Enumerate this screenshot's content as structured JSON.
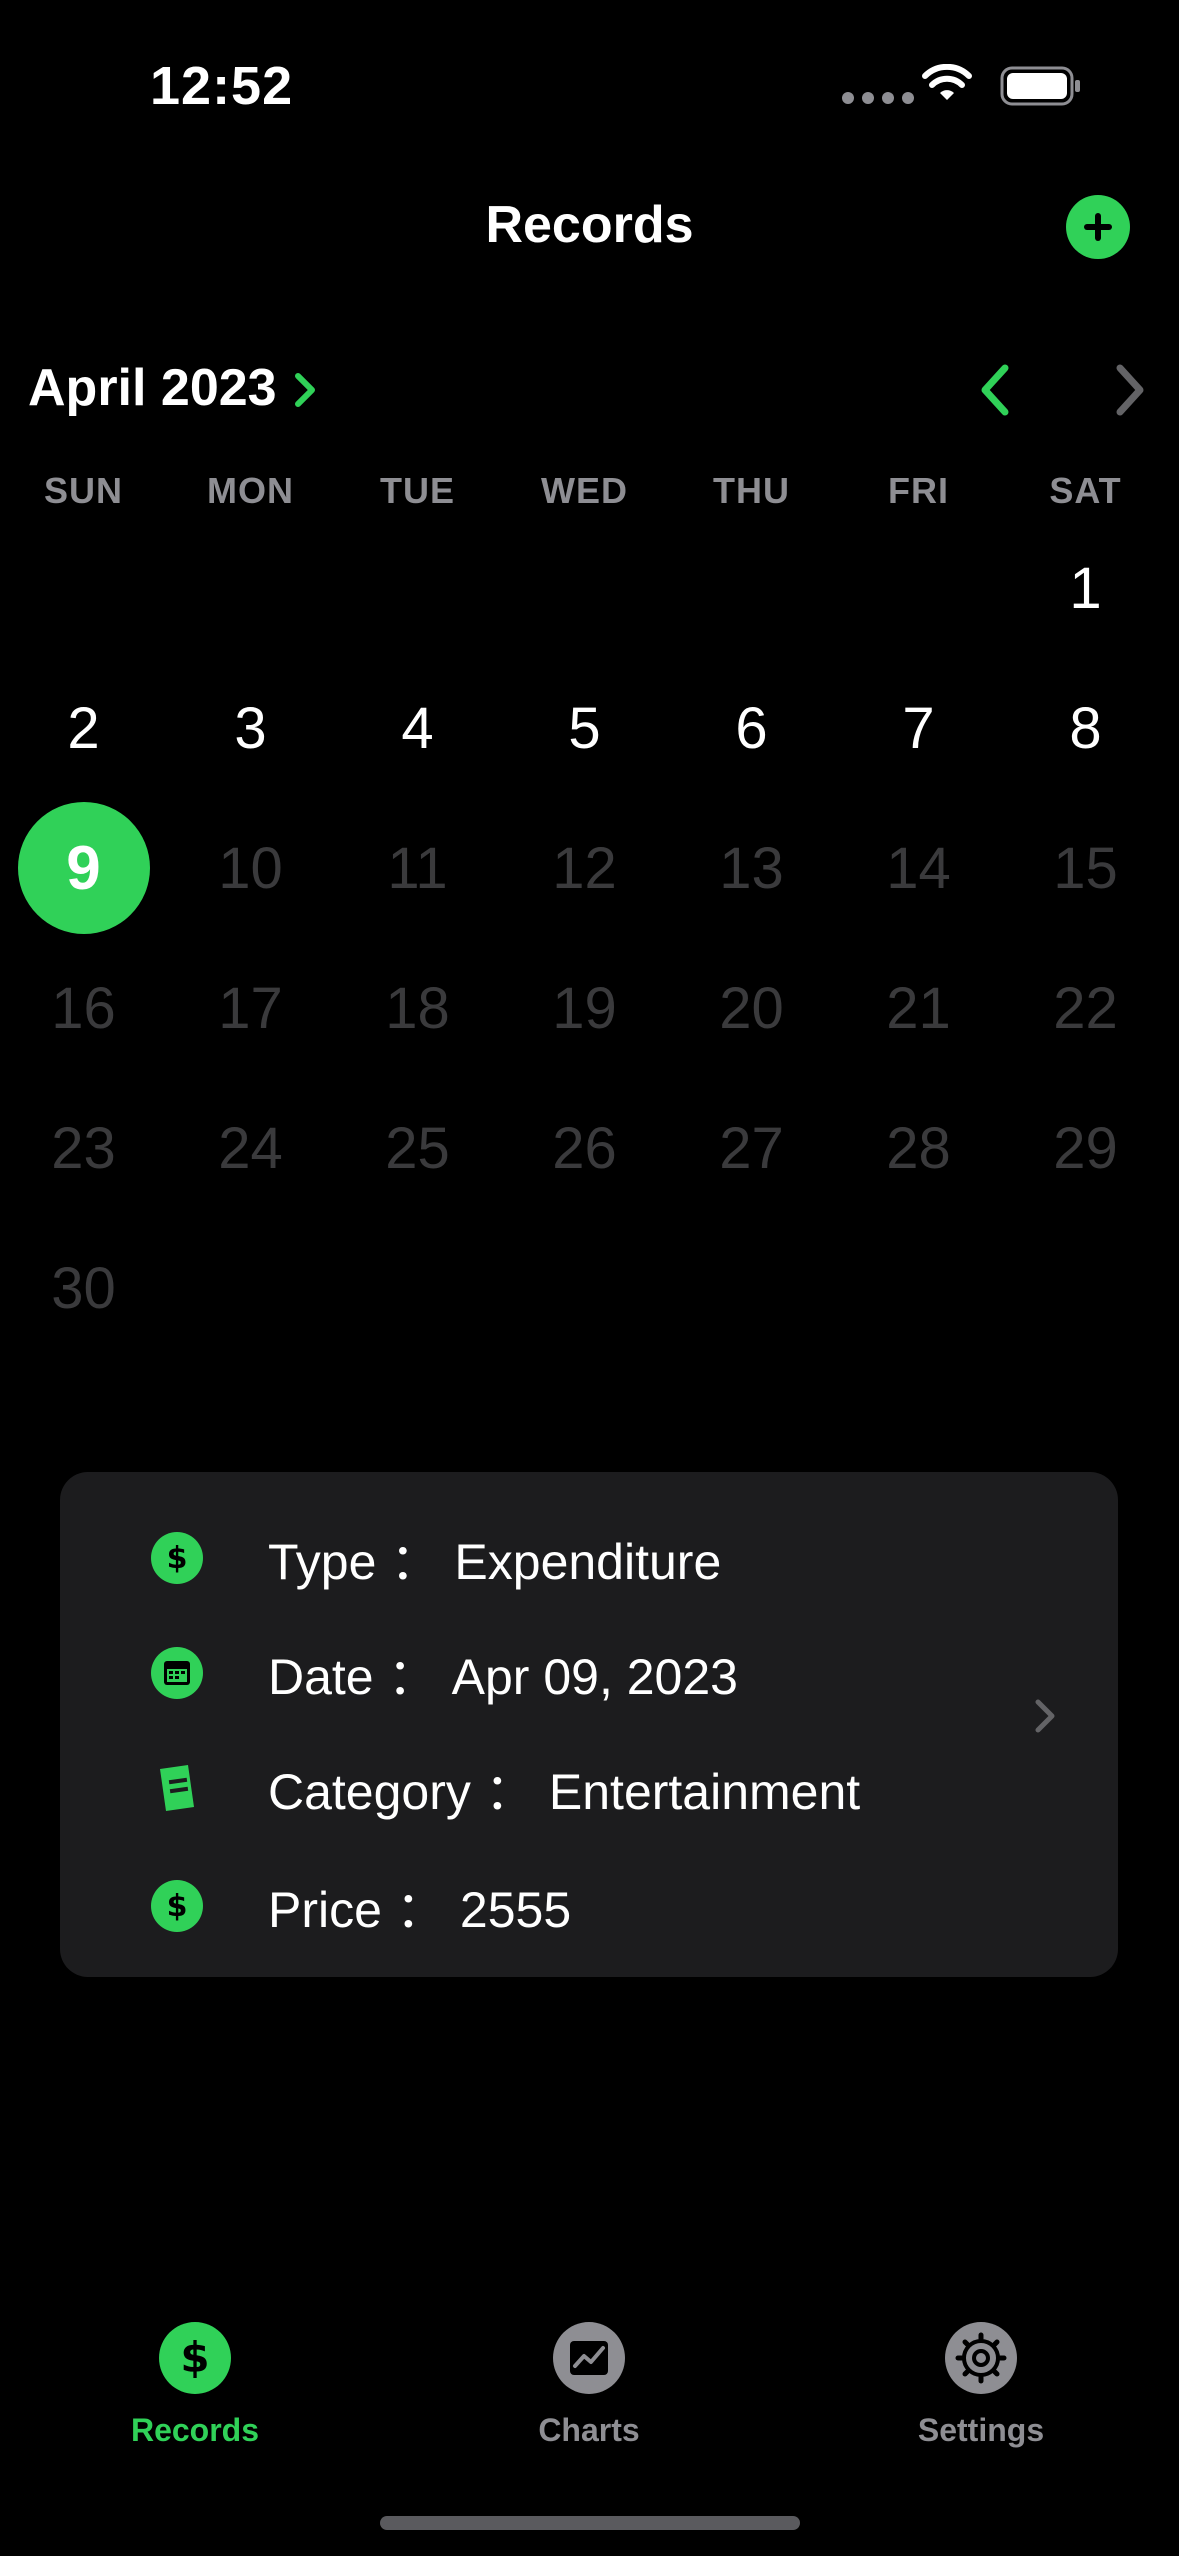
{
  "status_bar": {
    "time": "12:52"
  },
  "header": {
    "title": "Records",
    "add_icon": "plus-circle-icon"
  },
  "calendar": {
    "month_label": "April 2023",
    "weekdays": [
      "SUN",
      "MON",
      "TUE",
      "WED",
      "THU",
      "FRI",
      "SAT"
    ],
    "days": [
      "1",
      "2",
      "3",
      "4",
      "5",
      "6",
      "7",
      "8",
      "9",
      "10",
      "11",
      "12",
      "13",
      "14",
      "15",
      "16",
      "17",
      "18",
      "19",
      "20",
      "21",
      "22",
      "23",
      "24",
      "25",
      "26",
      "27",
      "28",
      "29",
      "30"
    ],
    "selected_day": "9",
    "start_weekday_index": 6
  },
  "record": {
    "type_key": "Type",
    "type_value": "Expenditure",
    "date_key": "Date",
    "date_value": "Apr 09, 2023",
    "category_key": "Category",
    "category_value": "Entertainment",
    "price_key": "Price",
    "price_value": "2555",
    "separator": "："
  },
  "tabs": [
    {
      "label": "Records",
      "icon": "dollar-icon",
      "active": true
    },
    {
      "label": "Charts",
      "icon": "chart-icon",
      "active": false
    },
    {
      "label": "Settings",
      "icon": "gear-icon",
      "active": false
    }
  ],
  "colors": {
    "accent": "#30d158",
    "muted_day": "#3a3a3c",
    "card_bg": "#1c1c1e",
    "inactive_tab": "#8e8e93"
  }
}
